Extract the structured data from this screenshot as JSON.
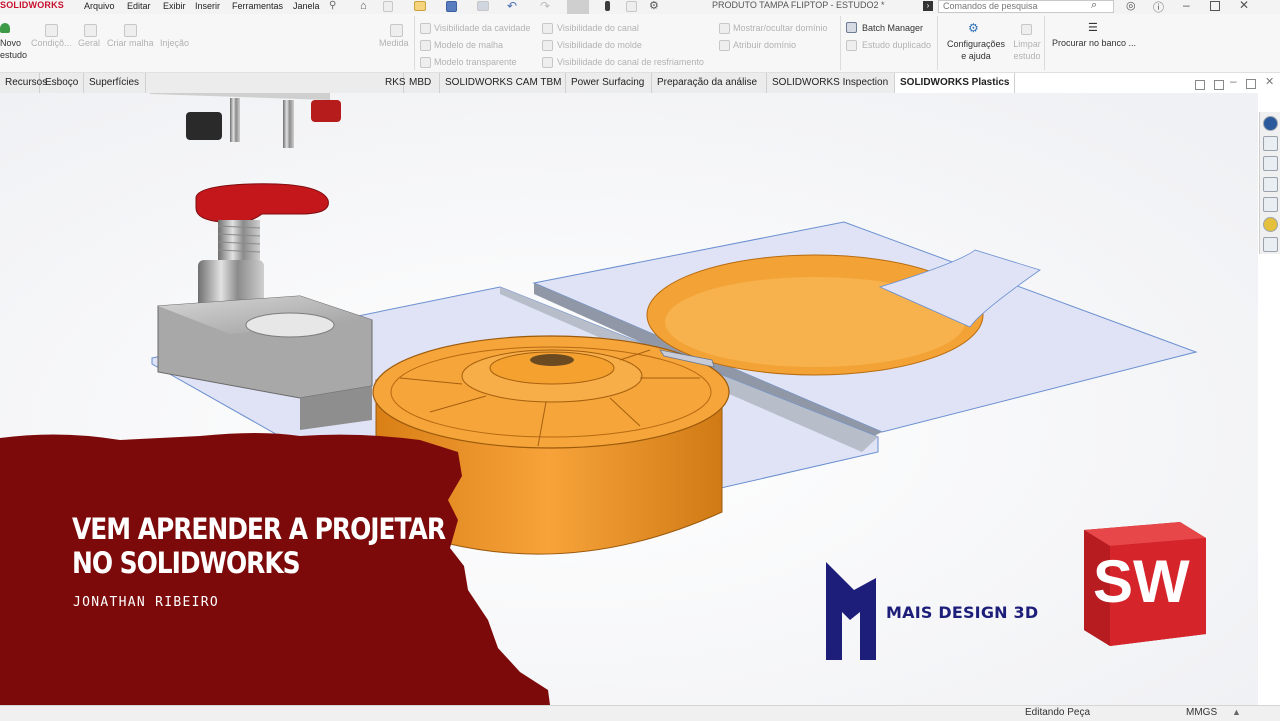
{
  "app": {
    "brand": "SOLIDWORKS",
    "document_title": "PRODUTO TAMPA FLIPTOP - ESTUDO2 *"
  },
  "menu": [
    "Arquivo",
    "Editar",
    "Exibir",
    "Inserir",
    "Ferramentas",
    "Janela"
  ],
  "search": {
    "placeholder": "Comandos de pesquisa"
  },
  "ribbon": {
    "left_buttons": [
      "Novo estudo",
      "Condiçõ...",
      "Geral",
      "Criar malha",
      "Injeção",
      "Medida"
    ],
    "group_visibility": [
      "Visibilidade da cavidade",
      "Modelo de malha",
      "Modelo transparente"
    ],
    "group_channels": [
      "Visibilidade do canal",
      "Visibilidade do molde",
      "Visibilidade do canal de resfriamento"
    ],
    "group_domain": [
      "Mostrar/ocultar domínio",
      "Atribuir domínio"
    ],
    "batch_manager": "Batch Manager",
    "estudo_duplicado": "Estudo duplicado",
    "config_label": "Configurações e ajuda",
    "limpar_label": "Limpar estudo",
    "procurar_label": "Procurar no banco ..."
  },
  "tabs": [
    "Recursos",
    "Esboço",
    "Superfícies",
    "MBD",
    "SOLIDWORKS CAM TBM",
    "Power Surfacing",
    "Preparação da análise",
    "SOLIDWORKS Inspection",
    "SOLIDWORKS Plastics"
  ],
  "tabs_partial": "RKS",
  "active_tab": "SOLIDWORKS Plastics",
  "status": {
    "mode": "Editando Peça",
    "units": "MMGS"
  },
  "overlay": {
    "headline_line1": "VEM APRENDER A PROJETAR",
    "headline_line2": "NO SOLIDWORKS",
    "author": "JONATHAN RIBEIRO",
    "brand_name": "MAIS DESIGN 3D",
    "sw_letters": "SW"
  },
  "colors": {
    "accent_red": "#7d0a0a",
    "part_orange": "#f5a53a",
    "mold_blue": "#dfe4f4",
    "brand_navy": "#1d1e7a",
    "sw_red": "#d5252b"
  }
}
